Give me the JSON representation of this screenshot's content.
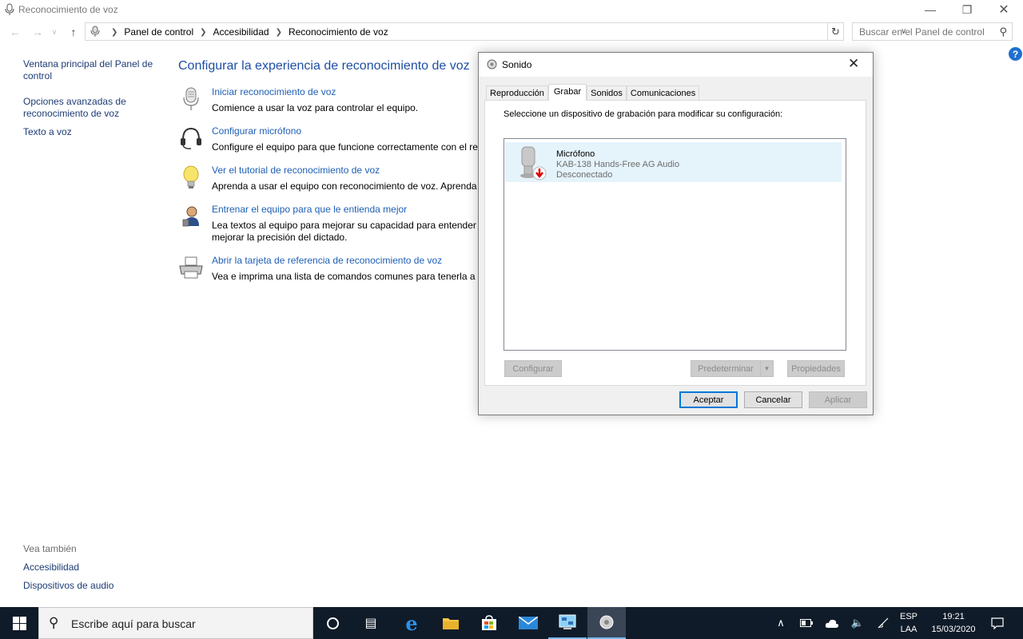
{
  "window": {
    "title": "Reconocimiento de voz"
  },
  "breadcrumb": [
    "Panel de control",
    "Accesibilidad",
    "Reconocimiento de voz"
  ],
  "search": {
    "placeholder": "Buscar en el Panel de control"
  },
  "leftnav": {
    "items": [
      "Ventana principal del Panel de control",
      "Opciones avanzadas de reconocimiento de voz",
      "Texto a voz"
    ],
    "see_also_header": "Vea también",
    "see_also": [
      "Accesibilidad",
      "Dispositivos de audio"
    ]
  },
  "main": {
    "heading": "Configurar la experiencia de reconocimiento de voz",
    "tasks": [
      {
        "icon": "microphone-icon",
        "link": "Iniciar reconocimiento de voz",
        "desc": "Comience a usar la voz para controlar el equipo."
      },
      {
        "icon": "headset-icon",
        "link": "Configurar micrófono",
        "desc": "Configure el equipo para que funcione correctamente con el re"
      },
      {
        "icon": "lightbulb-icon",
        "link": "Ver el tutorial de reconocimiento de voz",
        "desc": "Aprenda a usar el equipo con reconocimiento de voz. Aprenda"
      },
      {
        "icon": "user-icon",
        "link": "Entrenar el equipo para que le entienda mejor",
        "desc": "Lea textos al equipo para mejorar su capacidad para entender su",
        "desc2": "mejorar la precisión del dictado."
      },
      {
        "icon": "printer-icon",
        "link": "Abrir la tarjeta de referencia de reconocimiento de voz",
        "desc": "Vea e imprima una lista de comandos comunes para tenerla a m"
      }
    ]
  },
  "dialog": {
    "title": "Sonido",
    "tabs": [
      "Reproducción",
      "Grabar",
      "Sonidos",
      "Comunicaciones"
    ],
    "active_tab": "Grabar",
    "instruction": "Seleccione un dispositivo de grabación para modificar su configuración:",
    "device": {
      "name": "Micrófono",
      "model": "KAB-138 Hands-Free AG Audio",
      "status": "Desconectado"
    },
    "buttons": {
      "configure": "Configurar",
      "set_default": "Predeterminar",
      "properties": "Propiedades",
      "ok": "Aceptar",
      "cancel": "Cancelar",
      "apply": "Aplicar"
    }
  },
  "taskbar": {
    "search_placeholder": "Escribe aquí para buscar",
    "lang1": "ESP",
    "lang2": "LAA",
    "time": "19:21",
    "date": "15/03/2020"
  }
}
